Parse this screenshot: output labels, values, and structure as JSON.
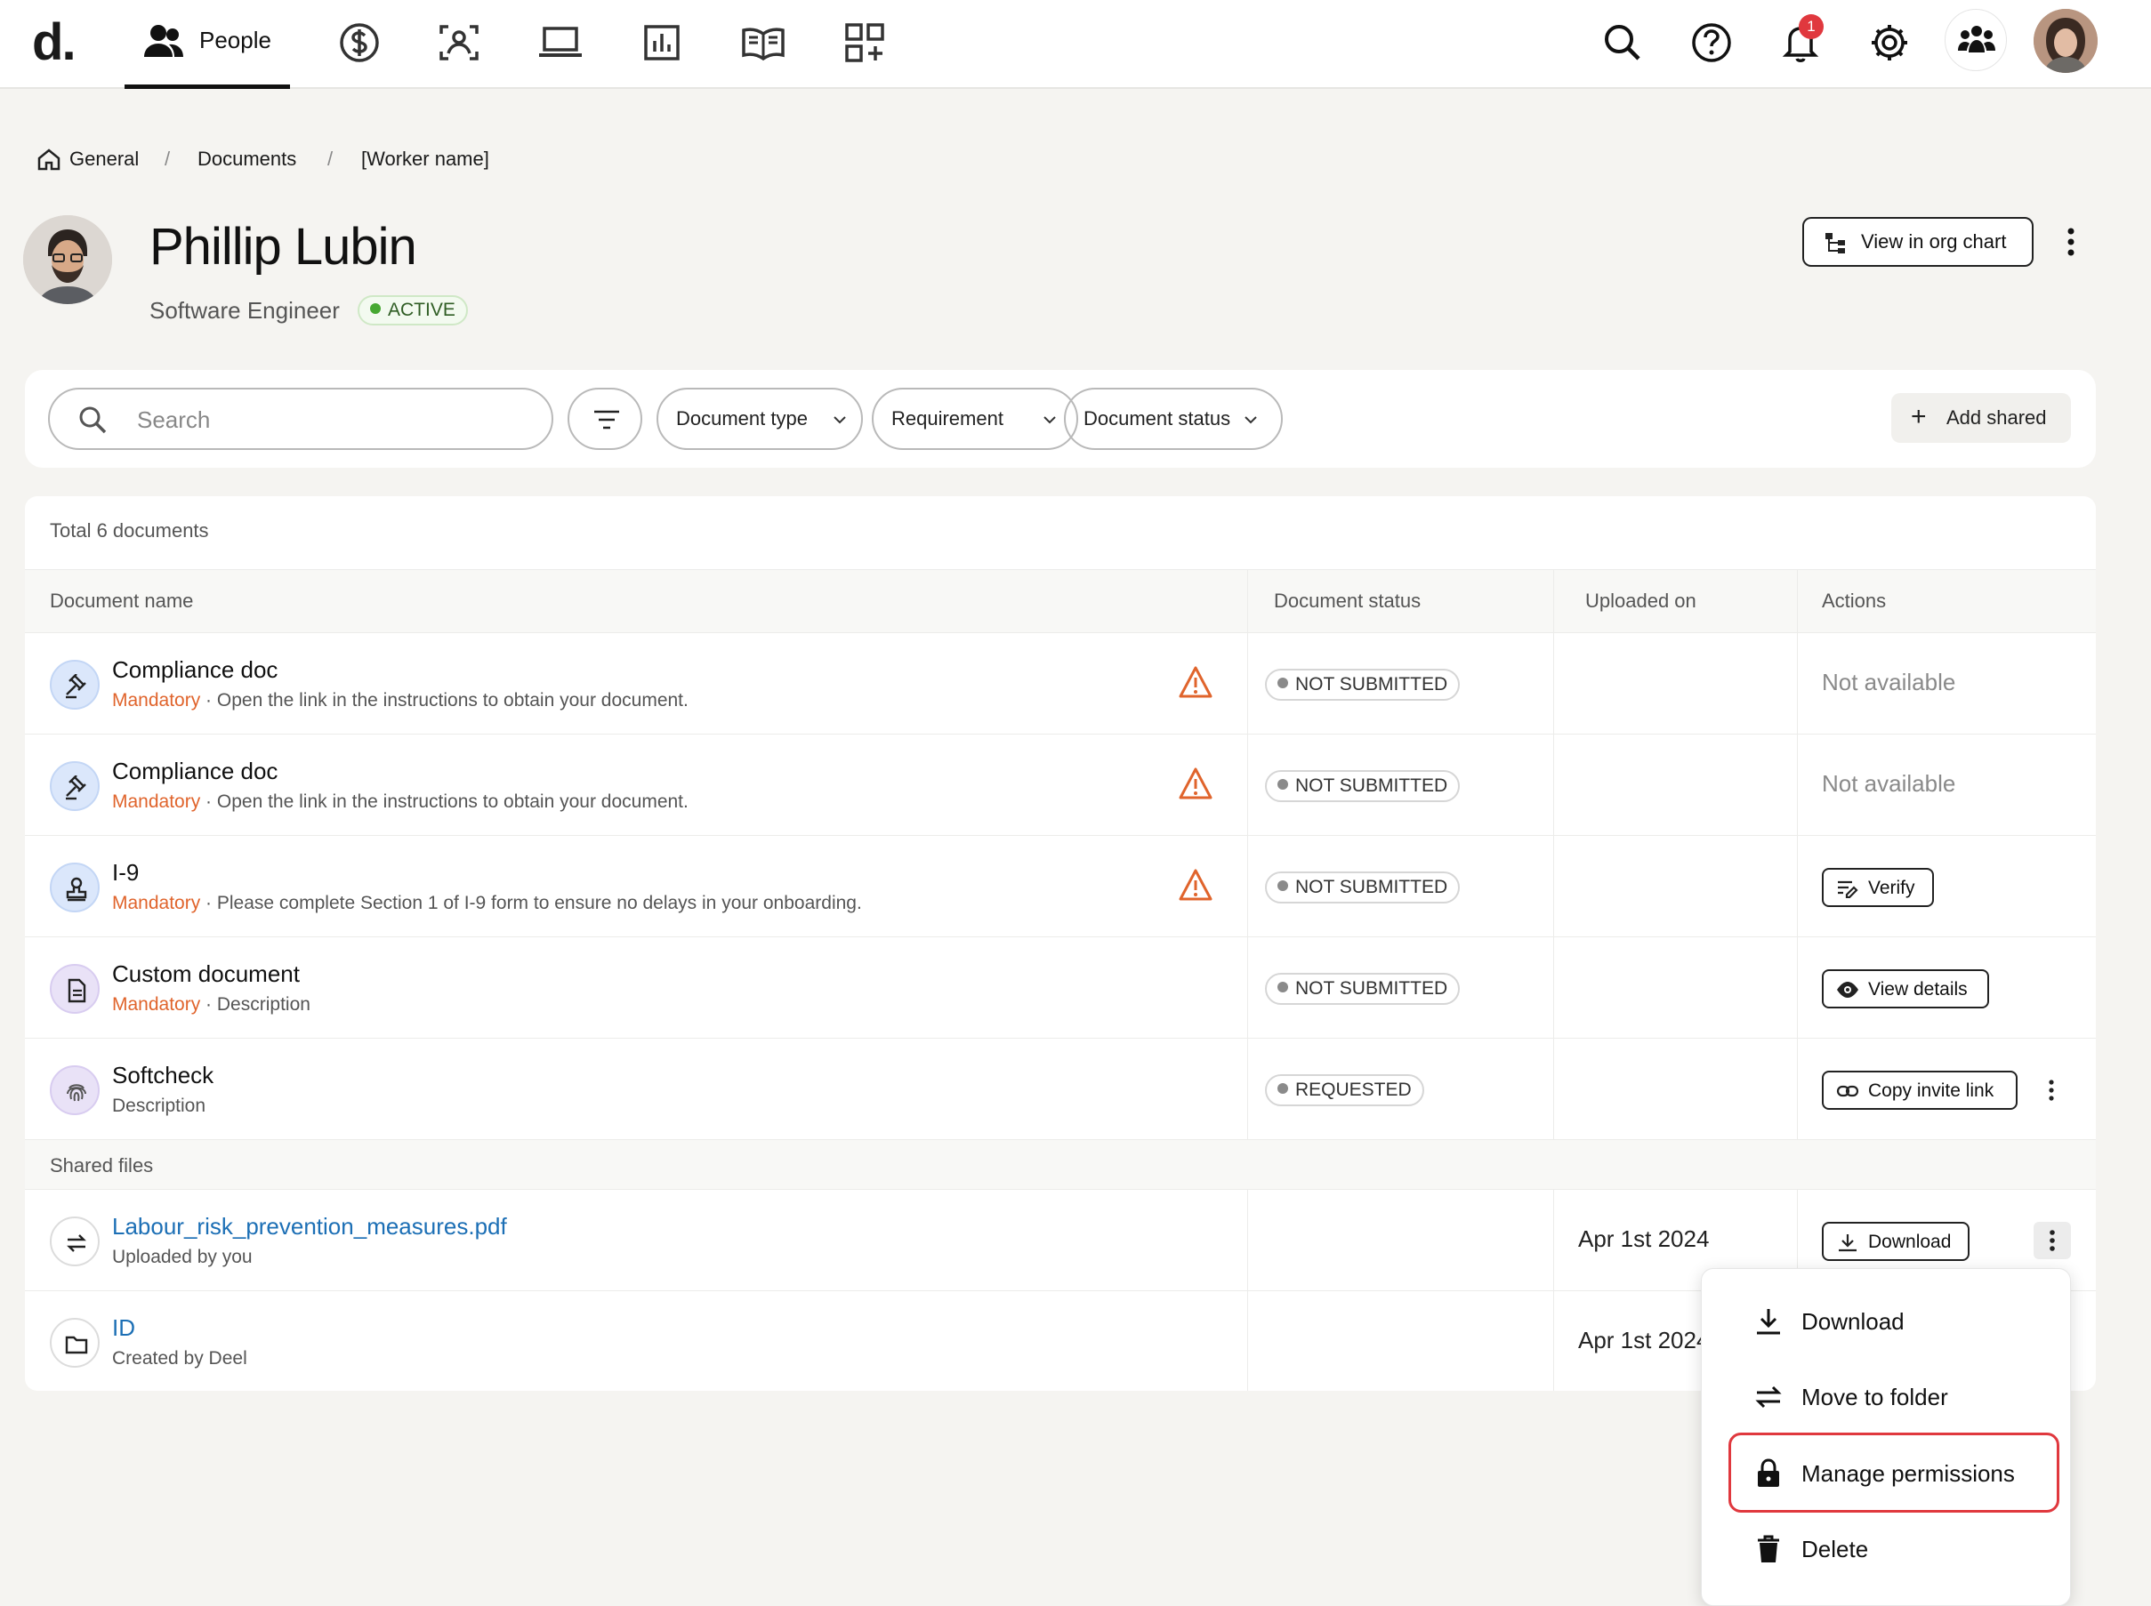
{
  "nav": {
    "logo": "d",
    "logo_dot": ".",
    "active_tab": "People",
    "notification_count": "1"
  },
  "breadcrumb": {
    "items": [
      "General",
      "Documents",
      "[Worker name]"
    ],
    "separator": "/"
  },
  "profile": {
    "name": "Phillip Lubin",
    "role": "Software Engineer",
    "status": "ACTIVE",
    "org_chart_button": "View in org chart"
  },
  "filters": {
    "search_placeholder": "Search",
    "chips": [
      "Document type",
      "Requirement",
      "Document status"
    ],
    "add_shared": "Add shared"
  },
  "table": {
    "total": "Total 6 documents",
    "columns": [
      "Document name",
      "Document status",
      "Uploaded on",
      "Actions"
    ],
    "rows": [
      {
        "title": "Compliance doc",
        "tag": "Mandatory",
        "sub": " · Open the link in the instructions to obtain your document.",
        "status": "NOT SUBMITTED",
        "action": "Not available",
        "icon": "gavel-icon"
      },
      {
        "title": "Compliance doc",
        "tag": "Mandatory",
        "sub": " · Open the link in the instructions to obtain your document.",
        "status": "NOT SUBMITTED",
        "action": "Not available",
        "icon": "gavel-icon"
      },
      {
        "title": "I-9",
        "tag": "Mandatory",
        "sub": " · Please complete Section 1 of I-9 form to ensure no delays in your onboarding.",
        "status": "NOT SUBMITTED",
        "action": "Verify",
        "icon": "stamp-icon"
      },
      {
        "title": "Custom document",
        "tag": "Mandatory",
        "sub": " · Description",
        "status": "NOT SUBMITTED",
        "action": "View details",
        "icon": "document-icon"
      },
      {
        "title": "Softcheck",
        "tag": "",
        "sub": "Description",
        "status": "REQUESTED",
        "action": "Copy invite link",
        "icon": "fingerprint-icon"
      }
    ],
    "shared_header": "Shared files",
    "shared": [
      {
        "title": "Labour_risk_prevention_measures.pdf",
        "sub": "Uploaded by you",
        "date": "Apr 1st 2024",
        "action": "Download",
        "icon": "swap-arrows-icon"
      },
      {
        "title": "ID",
        "sub": "Created by Deel",
        "date": "Apr 1st 2024",
        "icon": "folder-icon"
      }
    ]
  },
  "menu": {
    "items": [
      "Download",
      "Move to folder",
      "Manage permissions",
      "Delete"
    ],
    "highlighted": "Manage permissions"
  },
  "colors": {
    "accent_link": "#1c6fb5",
    "mandatory": "#e0642c",
    "warning": "#e0642c",
    "active_green": "#46a832",
    "badge_red": "#e0383e",
    "highlight": "#e0383e"
  }
}
